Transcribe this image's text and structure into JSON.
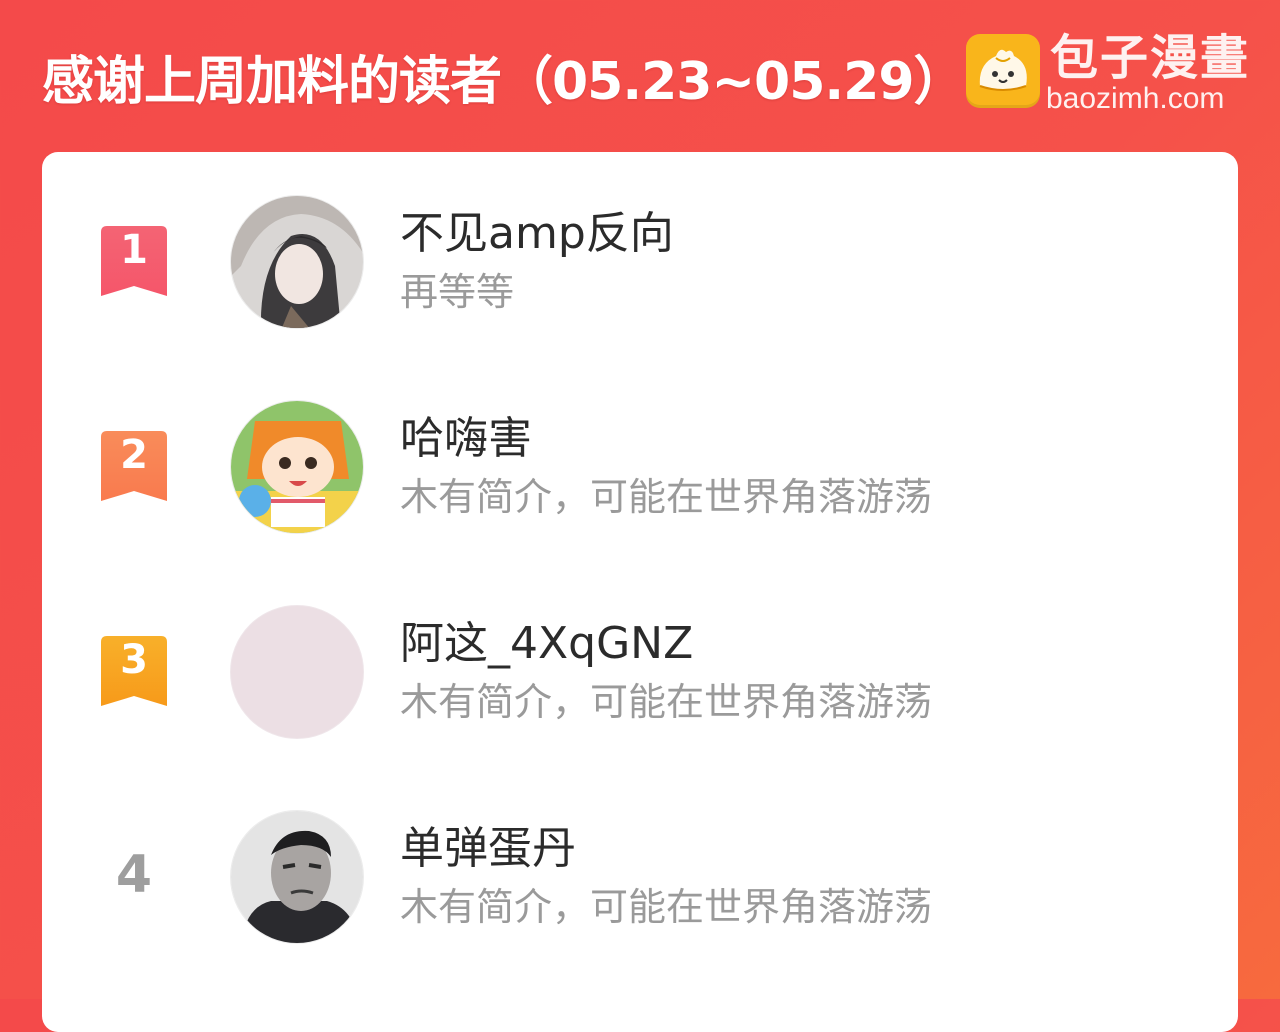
{
  "header": {
    "title": "感谢上周加料的读者（05.23~05.29）"
  },
  "brand": {
    "name": "包子漫畫",
    "domain": "baozimh.com",
    "icon": "bun-mascot-icon",
    "icon_color": "#f9b51b"
  },
  "colors": {
    "background": "#f44a4a",
    "card": "#ffffff",
    "rank1": "#f5566a",
    "rank2": "#f97a4e",
    "rank3": "#f7a21c",
    "rank_plain": "#9e9e9e"
  },
  "readers": [
    {
      "rank": "1",
      "name": "不见amp反向",
      "bio": "再等等",
      "avatar": "anime-girl-avatar"
    },
    {
      "rank": "2",
      "name": "哈嗨害",
      "bio": "木有简介，可能在世界角落游荡",
      "avatar": "umaru-avatar"
    },
    {
      "rank": "3",
      "name": "阿这_4XqGNZ",
      "bio": "木有简介，可能在世界角落游荡",
      "avatar": "blank-avatar"
    },
    {
      "rank": "4",
      "name": "单弹蛋丹",
      "bio": "木有简介，可能在世界角落游荡",
      "avatar": "man-portrait-avatar"
    }
  ]
}
